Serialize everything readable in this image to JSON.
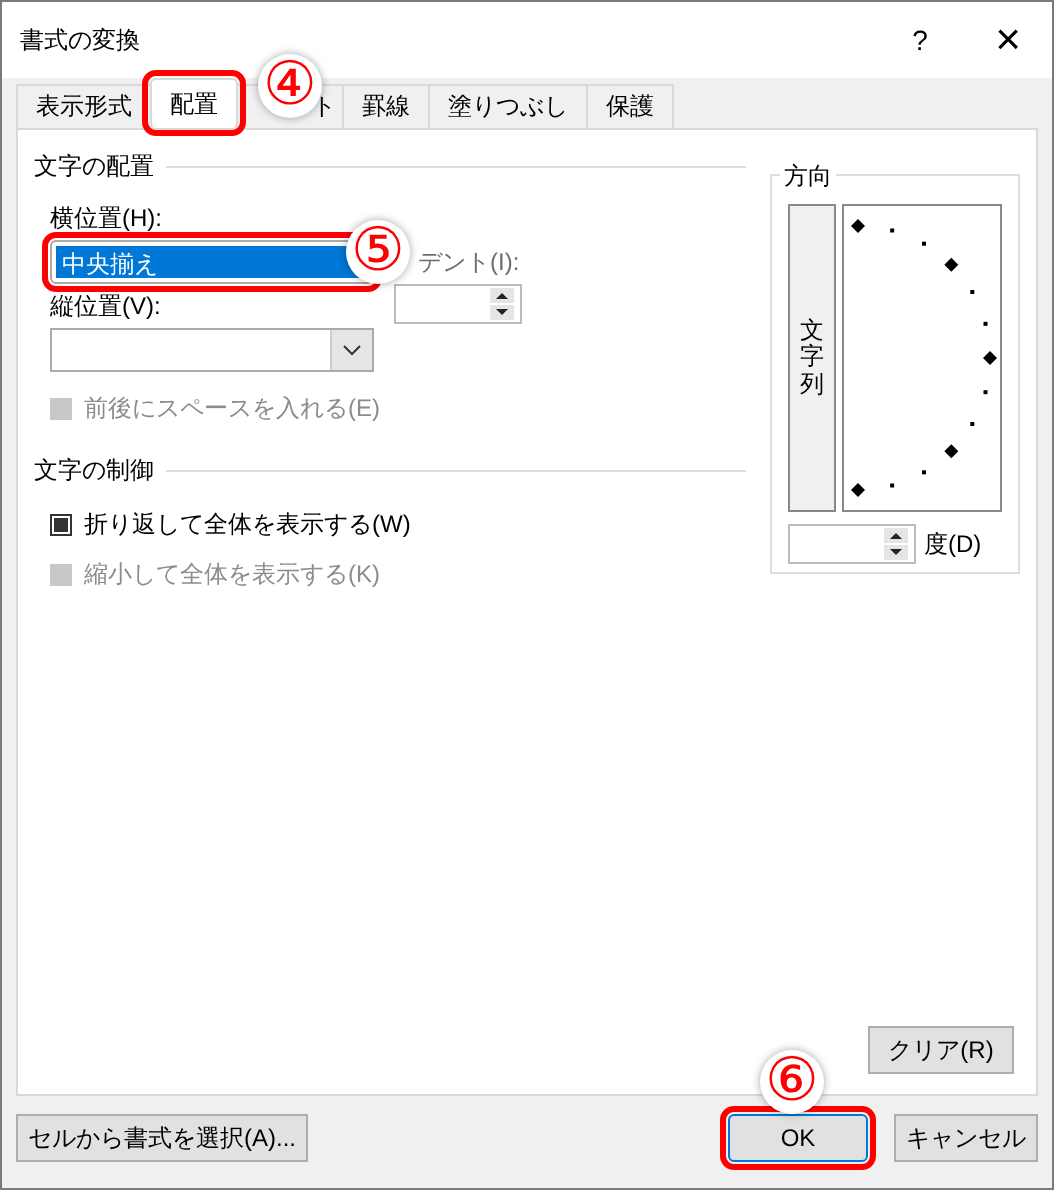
{
  "window": {
    "title": "書式の変換",
    "help": "?",
    "close": "×"
  },
  "tabs": [
    {
      "label": "表示形式",
      "selected": false,
      "highlighted": false
    },
    {
      "label": "配置",
      "selected": true,
      "highlighted": true
    },
    {
      "label": "ト",
      "selected": false,
      "highlighted": false
    },
    {
      "label": "罫線",
      "selected": false,
      "highlighted": false
    },
    {
      "label": "塗りつぶし",
      "selected": false,
      "highlighted": false
    },
    {
      "label": "保護",
      "selected": false,
      "highlighted": false
    }
  ],
  "alignment": {
    "heading": "文字の配置",
    "horizontal": {
      "label": "横位置(H):",
      "value": "中央揃え",
      "highlighted": true
    },
    "indent": {
      "label": "デント(I):"
    },
    "vertical": {
      "label": "縦位置(V):"
    },
    "checkboxes": [
      {
        "label": "前後にスペースを入れる(E)",
        "checked": false,
        "disabled": true
      }
    ]
  },
  "text_control": {
    "heading": "文字の制御",
    "checkboxes": [
      {
        "label": "折り返して全体を表示する(W)",
        "checked": true,
        "disabled": false
      },
      {
        "label": "縮小して全体を表示する(K)",
        "checked": false,
        "disabled": true
      }
    ]
  },
  "orientation": {
    "heading": "方向",
    "vertical_text": "文字列",
    "degrees_label": "度(D)"
  },
  "clear_button": "クリア(R)",
  "buttons": [
    {
      "label": "セルから書式を選択(A)...",
      "highlighted": false
    },
    {
      "label": "OK",
      "highlighted": true
    },
    {
      "label": "キャンセル",
      "highlighted": false
    }
  ],
  "annotations": [
    {
      "label": "④"
    },
    {
      "label": "⑤"
    },
    {
      "label": "⑥"
    }
  ]
}
